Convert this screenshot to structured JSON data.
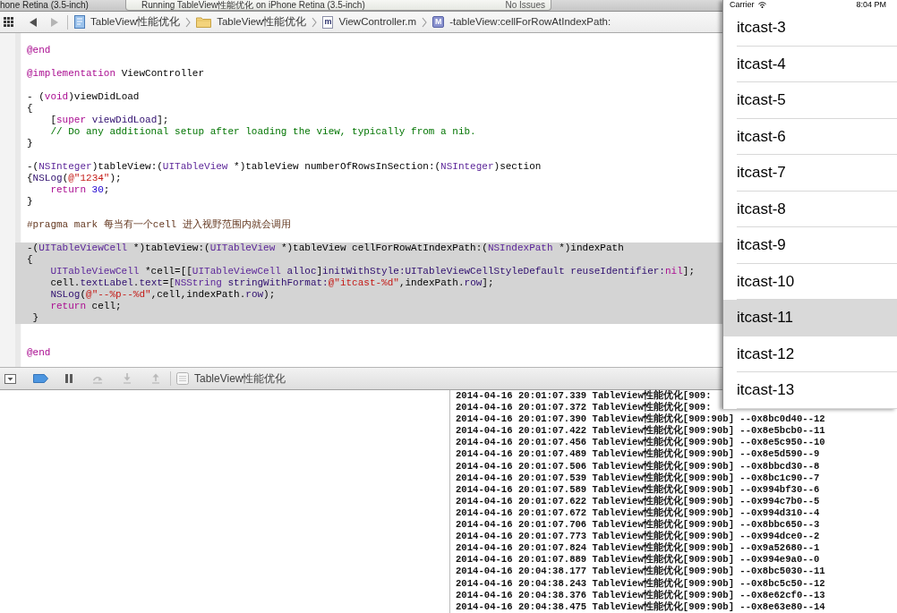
{
  "toolbar": {
    "destination": "hone Retina (3.5-inch)",
    "activity": "Running TableView性能优化 on iPhone Retina (3.5-inch)",
    "issues": "No Issues"
  },
  "jump_bar": {
    "navigation": [
      {
        "kind": "back",
        "disabled": false
      },
      {
        "kind": "forward",
        "disabled": true
      }
    ],
    "items": [
      {
        "kind": "project",
        "label": "TableView性能优化"
      },
      {
        "kind": "group",
        "label": "TableView性能优化"
      },
      {
        "kind": "source-file",
        "icon_letter": "m",
        "label": "ViewController.m"
      },
      {
        "kind": "method",
        "icon_letter": "M",
        "label": "-tableView:cellForRowAtIndexPath:"
      }
    ]
  },
  "editor": {
    "lines": [
      {
        "highlighted": false
      },
      {
        "highlighted": false,
        "tokens": [
          {
            "text": "@end",
            "kind": "keyword"
          }
        ]
      },
      {
        "highlighted": false
      },
      {
        "highlighted": false,
        "tokens": [
          {
            "text": "@implementation",
            "kind": "keyword"
          },
          {
            "text": " ViewController",
            "kind": "plain"
          }
        ]
      },
      {
        "highlighted": false
      },
      {
        "highlighted": false,
        "tokens": [
          {
            "text": "- (",
            "kind": "plain"
          },
          {
            "text": "void",
            "kind": "keyword"
          },
          {
            "text": ")viewDidLoad",
            "kind": "plain"
          }
        ]
      },
      {
        "highlighted": false,
        "tokens": [
          {
            "text": "{",
            "kind": "plain"
          }
        ]
      },
      {
        "highlighted": false,
        "tokens": [
          {
            "text": "    [",
            "kind": "plain"
          },
          {
            "text": "super",
            "kind": "keyword"
          },
          {
            "text": " viewDidLoad",
            "kind": "method"
          },
          {
            "text": "];",
            "kind": "plain"
          }
        ]
      },
      {
        "highlighted": false,
        "tokens": [
          {
            "text": "    // Do any additional setup after loading the view, typically from a nib.",
            "kind": "comment"
          }
        ]
      },
      {
        "highlighted": false,
        "tokens": [
          {
            "text": "}",
            "kind": "plain"
          }
        ]
      },
      {
        "highlighted": false
      },
      {
        "highlighted": false,
        "tokens": [
          {
            "text": "-(",
            "kind": "plain"
          },
          {
            "text": "NSInteger",
            "kind": "class"
          },
          {
            "text": ")tableView:(",
            "kind": "plain"
          },
          {
            "text": "UITableView",
            "kind": "class"
          },
          {
            "text": " *)tableView numberOfRowsInSection:(",
            "kind": "plain"
          },
          {
            "text": "NSInteger",
            "kind": "class"
          },
          {
            "text": ")section",
            "kind": "plain"
          }
        ]
      },
      {
        "highlighted": false,
        "tokens": [
          {
            "text": "{",
            "kind": "plain"
          },
          {
            "text": "NSLog",
            "kind": "method"
          },
          {
            "text": "(",
            "kind": "plain"
          },
          {
            "text": "@\"1234\"",
            "kind": "string"
          },
          {
            "text": ");",
            "kind": "plain"
          }
        ]
      },
      {
        "highlighted": false,
        "tokens": [
          {
            "text": "    return",
            "kind": "keyword"
          },
          {
            "text": " 30",
            "kind": "number"
          },
          {
            "text": ";",
            "kind": "plain"
          }
        ]
      },
      {
        "highlighted": false,
        "tokens": [
          {
            "text": "}",
            "kind": "plain"
          }
        ]
      },
      {
        "highlighted": false
      },
      {
        "highlighted": false,
        "tokens": [
          {
            "text": "#pragma mark 每当有一个cell 进入视野范围内就会调用",
            "kind": "directive"
          }
        ]
      },
      {
        "highlighted": false
      },
      {
        "highlighted": true,
        "tokens": [
          {
            "text": "-(",
            "kind": "plain"
          },
          {
            "text": "UITableViewCell",
            "kind": "class"
          },
          {
            "text": " *)tableView:(",
            "kind": "plain"
          },
          {
            "text": "UITableView",
            "kind": "class"
          },
          {
            "text": " *)tableView cellForRowAtIndexPath:(",
            "kind": "plain"
          },
          {
            "text": "NSIndexPath",
            "kind": "class"
          },
          {
            "text": " *)indexPath",
            "kind": "plain"
          }
        ]
      },
      {
        "highlighted": true,
        "tokens": [
          {
            "text": "{",
            "kind": "plain"
          }
        ]
      },
      {
        "highlighted": true,
        "tokens": [
          {
            "text": "    UITableViewCell",
            "kind": "class"
          },
          {
            "text": " *cell=[[",
            "kind": "plain"
          },
          {
            "text": "UITableViewCell",
            "kind": "class"
          },
          {
            "text": " alloc",
            "kind": "method"
          },
          {
            "text": "]",
            "kind": "plain"
          },
          {
            "text": "initWithStyle:UITableViewCellStyleDefault reuseIdentifier:",
            "kind": "method"
          },
          {
            "text": "nil",
            "kind": "keyword"
          },
          {
            "text": "];",
            "kind": "plain"
          }
        ]
      },
      {
        "highlighted": true,
        "tokens": [
          {
            "text": "    cell.",
            "kind": "plain"
          },
          {
            "text": "textLabel",
            "kind": "method"
          },
          {
            "text": ".",
            "kind": "plain"
          },
          {
            "text": "text",
            "kind": "method"
          },
          {
            "text": "=[",
            "kind": "plain"
          },
          {
            "text": "NSString",
            "kind": "class"
          },
          {
            "text": " stringWithFormat:",
            "kind": "method"
          },
          {
            "text": "@\"itcast-%d\"",
            "kind": "string"
          },
          {
            "text": ",indexPath.",
            "kind": "plain"
          },
          {
            "text": "row",
            "kind": "method"
          },
          {
            "text": "];",
            "kind": "plain"
          }
        ]
      },
      {
        "highlighted": true,
        "tokens": [
          {
            "text": "    NSLog",
            "kind": "method"
          },
          {
            "text": "(",
            "kind": "plain"
          },
          {
            "text": "@\"--%p--%d\"",
            "kind": "string"
          },
          {
            "text": ",cell,indexPath.",
            "kind": "plain"
          },
          {
            "text": "row",
            "kind": "method"
          },
          {
            "text": ");",
            "kind": "plain"
          }
        ]
      },
      {
        "highlighted": true,
        "tokens": [
          {
            "text": "    return",
            "kind": "keyword"
          },
          {
            "text": " cell;",
            "kind": "plain"
          }
        ]
      },
      {
        "highlighted": true,
        "tokens": [
          {
            "text": " }",
            "kind": "plain"
          }
        ]
      },
      {
        "highlighted": false
      },
      {
        "highlighted": false
      },
      {
        "highlighted": false,
        "tokens": [
          {
            "text": "@end",
            "kind": "keyword"
          }
        ]
      }
    ]
  },
  "debug_bar": {
    "breakpoints_active": true,
    "buttons": [
      {
        "kind": "pause",
        "disabled": false
      },
      {
        "kind": "step-over",
        "disabled": true
      },
      {
        "kind": "step-into",
        "disabled": true
      },
      {
        "kind": "step-out",
        "disabled": true
      }
    ],
    "process": "TableView性能优化"
  },
  "console": {
    "lines": [
      "2014-04-16 20:01:07.339 TableView性能优化[909:",
      "2014-04-16 20:01:07.372 TableView性能优化[909:",
      "2014-04-16 20:01:07.390 TableView性能优化[909:90b] --0x8bc0d40--12",
      "2014-04-16 20:01:07.422 TableView性能优化[909:90b] --0x8e5bcb0--11",
      "2014-04-16 20:01:07.456 TableView性能优化[909:90b] --0x8e5c950--10",
      "2014-04-16 20:01:07.489 TableView性能优化[909:90b] --0x8e5d590--9",
      "2014-04-16 20:01:07.506 TableView性能优化[909:90b] --0x8bbcd30--8",
      "2014-04-16 20:01:07.539 TableView性能优化[909:90b] --0x8bc1c90--7",
      "2014-04-16 20:01:07.589 TableView性能优化[909:90b] --0x994bf30--6",
      "2014-04-16 20:01:07.622 TableView性能优化[909:90b] --0x994c7b0--5",
      "2014-04-16 20:01:07.672 TableView性能优化[909:90b] --0x994d310--4",
      "2014-04-16 20:01:07.706 TableView性能优化[909:90b] --0x8bbc650--3",
      "2014-04-16 20:01:07.773 TableView性能优化[909:90b] --0x994dce0--2",
      "2014-04-16 20:01:07.824 TableView性能优化[909:90b] --0x9a52680--1",
      "2014-04-16 20:01:07.889 TableView性能优化[909:90b] --0x994e9a0--0",
      "2014-04-16 20:04:38.177 TableView性能优化[909:90b] --0x8bc5030--11",
      "2014-04-16 20:04:38.243 TableView性能优化[909:90b] --0x8bc5c50--12",
      "2014-04-16 20:04:38.376 TableView性能优化[909:90b] --0x8e62cf0--13",
      "2014-04-16 20:04:38.475 TableView性能优化[909:90b] --0x8e63e80--14"
    ]
  },
  "simulator": {
    "status_bar": {
      "carrier": "Carrier",
      "time": "8:04 PM"
    },
    "rows": [
      {
        "label": "itcast-3",
        "selected": false
      },
      {
        "label": "itcast-4",
        "selected": false
      },
      {
        "label": "itcast-5",
        "selected": false
      },
      {
        "label": "itcast-6",
        "selected": false
      },
      {
        "label": "itcast-7",
        "selected": false
      },
      {
        "label": "itcast-8",
        "selected": false
      },
      {
        "label": "itcast-9",
        "selected": false
      },
      {
        "label": "itcast-10",
        "selected": false
      },
      {
        "label": "itcast-11",
        "selected": true
      },
      {
        "label": "itcast-12",
        "selected": false
      },
      {
        "label": "itcast-13",
        "selected": false
      }
    ]
  }
}
